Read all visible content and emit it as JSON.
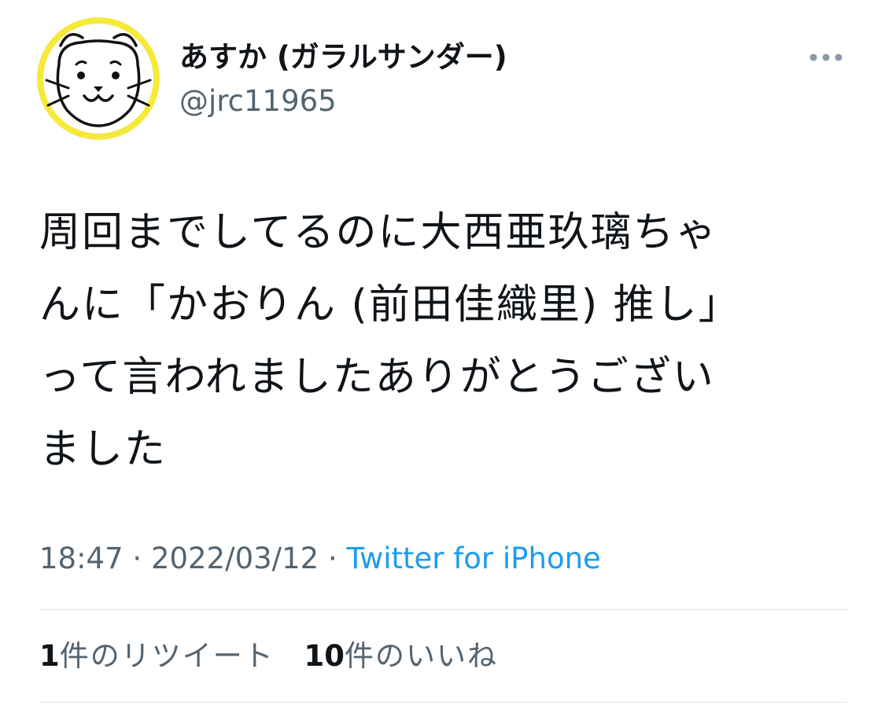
{
  "user": {
    "display_name": "あすか (ガラルサンダー)",
    "handle": "@jrc11965",
    "avatar_icon": "cat-face-avatar"
  },
  "tweet": {
    "lines": [
      "周回までしてるのに大西亜玖璃ちゃ",
      "んに「かおりん (前田佳織里) 推し」",
      "って言われましたありがとうござい",
      "ました"
    ],
    "time": "18:47",
    "separator": "·",
    "date": "2022/03/12",
    "source": "Twitter for iPhone"
  },
  "stats": {
    "retweets_count": "1",
    "retweets_label": "件のリツイート",
    "likes_count": "10",
    "likes_label": "件のいいね"
  },
  "colors": {
    "text_primary": "#0f1419",
    "text_secondary": "#536471",
    "link": "#1d9bf0",
    "avatar_ring": "#f5e93a",
    "divider": "#e1e5e8"
  },
  "icons": {
    "more": "more-options-icon"
  }
}
